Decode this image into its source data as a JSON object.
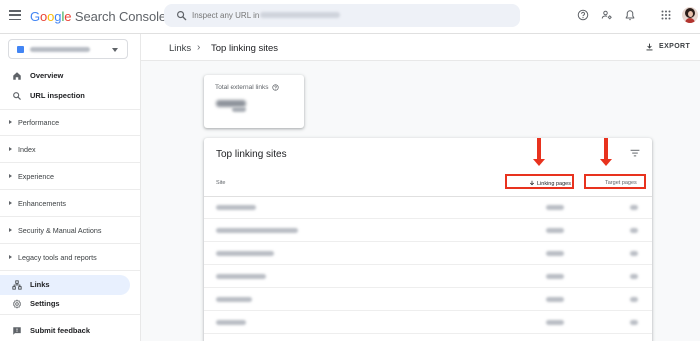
{
  "app": {
    "logo_google": [
      "G",
      "o",
      "o",
      "g",
      "l",
      "e"
    ],
    "logo_product": "Search Console"
  },
  "search": {
    "placeholder": "Inspect any URL in"
  },
  "sidebar": {
    "items": [
      {
        "label": "Overview",
        "icon": "home-icon"
      },
      {
        "label": "URL inspection",
        "icon": "search-icon"
      }
    ],
    "sections": [
      {
        "label": "Performance"
      },
      {
        "label": "Index"
      },
      {
        "label": "Experience"
      },
      {
        "label": "Enhancements"
      },
      {
        "label": "Security & Manual Actions"
      },
      {
        "label": "Legacy tools and reports"
      }
    ],
    "bottom_items": [
      {
        "label": "Links",
        "icon": "links-icon",
        "active": true
      },
      {
        "label": "Settings",
        "icon": "gear-icon"
      },
      {
        "label": "Submit feedback",
        "icon": "feedback-icon"
      }
    ]
  },
  "header": {
    "breadcrumb_parent": "Links",
    "breadcrumb_sep": "›",
    "title": "Top linking sites",
    "export_label": "EXPORT"
  },
  "total_card": {
    "label": "Total external links"
  },
  "table": {
    "title": "Top linking sites",
    "columns": {
      "site": "Site",
      "linking": "Linking pages",
      "target": "Target pages"
    },
    "row_count": 6
  },
  "colors": {
    "accent_blue": "#4285f4",
    "highlight_red": "#e8321e",
    "active_nav_bg": "#e8f0fe"
  }
}
